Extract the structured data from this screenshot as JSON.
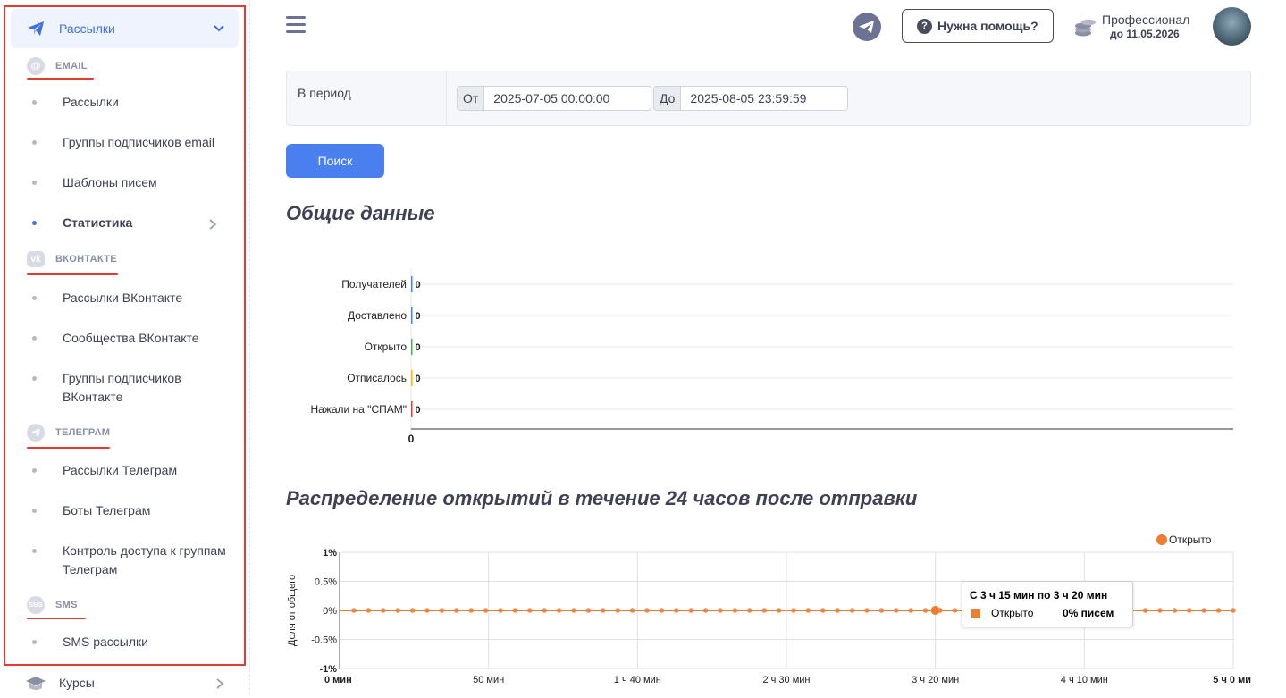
{
  "sidebar": {
    "top_item": {
      "label": "Рассылки",
      "icon": "paper-plane-icon"
    },
    "sections": [
      {
        "title": "EMAIL",
        "icon": "at-sign-icon",
        "items": [
          "Рассылки",
          "Группы подписчиков email",
          "Шаблоны писем",
          "Статистика"
        ]
      },
      {
        "title": "ВКОНТАКТЕ",
        "icon": "vk-icon",
        "items": [
          "Рассылки ВКонтакте",
          "Сообщества ВКонтакте",
          "Группы подписчиков ВКонтакте"
        ]
      },
      {
        "title": "ТЕЛЕГРАМ",
        "icon": "telegram-icon",
        "items": [
          "Рассылки Телеграм",
          "Боты Телеграм",
          "Контроль доступа к группам Телеграм"
        ]
      },
      {
        "title": "SMS",
        "icon": "sms-icon",
        "items": [
          "SMS рассылки"
        ]
      }
    ],
    "active_item": "Статистика",
    "bottom_item": {
      "label": "Курсы",
      "icon": "graduation-cap-icon"
    },
    "highlight_color": "#e53935",
    "accent_color": "#3e6fe0"
  },
  "header": {
    "help_label": "Нужна помощь?",
    "plan_name": "Профессионал",
    "plan_until": "до 11.05.2026"
  },
  "filter": {
    "period_label": "В период",
    "from_addon": "От",
    "from_value": "2025-07-05 00:00:00",
    "to_addon": "До",
    "to_value": "2025-08-05 23:59:59",
    "search_label": "Поиск"
  },
  "section_titles": {
    "general": "Общие данные",
    "distribution": "Распределение открытий в течение 24 часов после отправки"
  },
  "chart_data": [
    {
      "type": "bar",
      "orientation": "horizontal",
      "categories": [
        "Получателей",
        "Доставлено",
        "Открыто",
        "Отписалось",
        "Нажали на \"СПАМ\""
      ],
      "values": [
        0,
        0,
        0,
        0,
        0
      ],
      "x_tick_labels": [
        "0"
      ],
      "grid": true
    },
    {
      "type": "line",
      "series": [
        {
          "name": "Открыто",
          "color": "#ed7d31",
          "value": 0,
          "points": 61
        }
      ],
      "ylabel": "Доля от общего",
      "y_tick_labels": [
        "1%",
        "0.5%",
        "0%",
        "-0.5%",
        "-1%"
      ],
      "ylim": [
        -1,
        1
      ],
      "x_tick_labels": [
        "0 мин",
        "50 мин",
        "1 ч 40 мин",
        "2 ч 30 мин",
        "3 ч 20 мин",
        "4 ч 10 мин",
        "5 ч 0 ми"
      ],
      "legend": "top-right",
      "tooltip": {
        "title": "С 3 ч 15 мин по 3 ч 20 мин",
        "series": "Открыто",
        "value": "0% писем"
      }
    }
  ]
}
